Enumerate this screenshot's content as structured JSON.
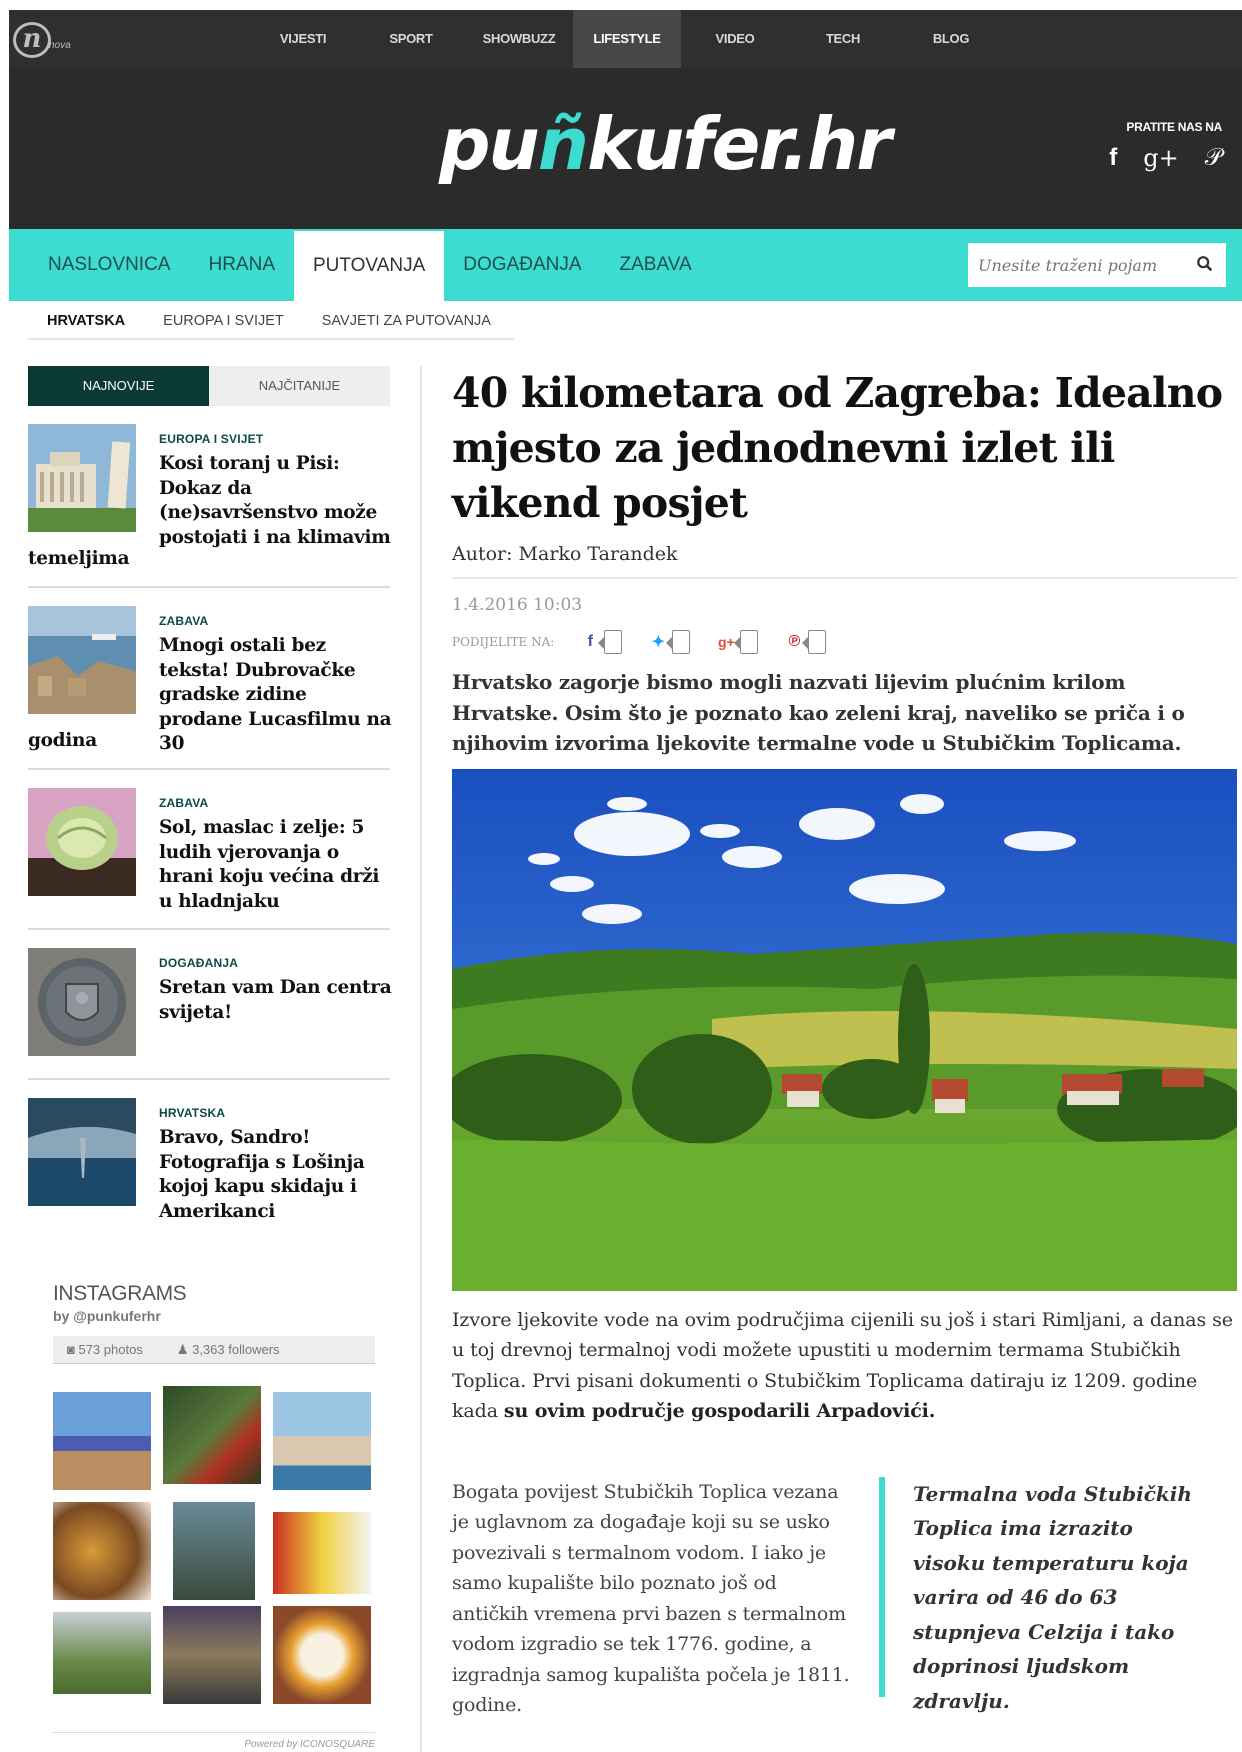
{
  "network": {
    "logo_letter": "n",
    "logo_word": "nova"
  },
  "topnav": [
    "VIJESTI",
    "SPORT",
    "SHOWBUZZ",
    "LIFESTYLE",
    "VIDEO",
    "TECH",
    "BLOG"
  ],
  "logo": {
    "part1": "pu",
    "part2": "ñ",
    "part3": "kufer.hr"
  },
  "follow": {
    "label": "PRATITE NAS NA",
    "icons": [
      "facebook-icon",
      "google-plus-icon",
      "pinterest-icon"
    ],
    "glyphs": [
      "f",
      "g+",
      "𝒫"
    ]
  },
  "catnav": [
    "NASLOVNICA",
    "HRANA",
    "PUTOVANJA",
    "DOGAĐANJA",
    "ZABAVA"
  ],
  "search": {
    "placeholder": "Unesite traženi pojam"
  },
  "subnav": [
    "HRVATSKA",
    "EUROPA I SVIJET",
    "SAVJETI ZA PUTOVANJA"
  ],
  "sidebar": {
    "tabs": [
      "NAJNOVIJE",
      "NAJČITANIJE"
    ],
    "posts": [
      {
        "category": "EUROPA I SVIJET",
        "title_main": "Kosi toranj u Pisi: Dokaz da (ne)savršenstvo može postojati i na klimavim",
        "title_tail": "temeljima"
      },
      {
        "category": "ZABAVA",
        "title_main": "Mnogi ostali bez teksta! Dubrovačke gradske zidine prodane Lucasfilmu na 30",
        "title_tail": "godina"
      },
      {
        "category": "ZABAVA",
        "title_main": "Sol, maslac i zelje: 5 ludih vjerovanja o hrani koju većina drži u hladnjaku",
        "title_tail": ""
      },
      {
        "category": "DOGAĐANJA",
        "title_main": "Sretan vam Dan centra svijeta!",
        "title_tail": ""
      },
      {
        "category": "HRVATSKA",
        "title_main": "Bravo, Sandro! Fotografija s Lošinja kojoj kapu skidaju i Amerikanci",
        "title_tail": ""
      }
    ]
  },
  "instagram": {
    "title": "INSTAGRAMS",
    "by": "by @punkuferhr",
    "photos": "573 photos",
    "followers": "3,363 followers",
    "powered": "Powered by ICONOSQUARE"
  },
  "article": {
    "headline": "40 kilometara od Zagreba: Idealno mjesto za jednodnevni izlet ili vikend posjet",
    "author": "Autor: Marko Tarandek",
    "date": "1.4.2016 10:03",
    "share_label": "PODIJELITE NA:",
    "lead": "Hrvatsko zagorje bismo mogli nazvati lijevim plućnim krilom Hrvatske. Osim što je poznato kao zeleni kraj, naveliko se priča i o njihovim izvorima ljekovite termalne vode u Stubičkim Toplicama.",
    "body1": "Izvore ljekovite vode na ovim područjima cijenili su još i stari Rimljani, a danas se u toj drevnoj termalnoj vodi možete upustiti u modernim termama Stubičkih Toplica. Prvi pisani dokumenti o Stubičkim Toplicama datiraju iz 1209. godine kada ",
    "body1_bold": "su ovim područje gospodarili Arpadovići.",
    "body2": "Bogata povijest Stubičkih Toplica vezana je uglavnom za događaje koji su se usko povezivali s termalnom vodom. I iako je samo kupalište bilo poznato još od antičkih vremena prvi bazen s termalnom vodom izgradio se tek 1776. godine, a izgradnja samog kupališta počela je 1811. godine.",
    "quote": "Termalna voda Stubičkih Toplica ima izrazito visoku temperaturu koja varira od 46 do 63 stupnjeva Celzija i tako doprinosi ljudskom zdravlju."
  },
  "colors": {
    "accent": "#3ddcd0",
    "dark": "#2b2b2b",
    "tab_dark": "#0b3a35"
  }
}
